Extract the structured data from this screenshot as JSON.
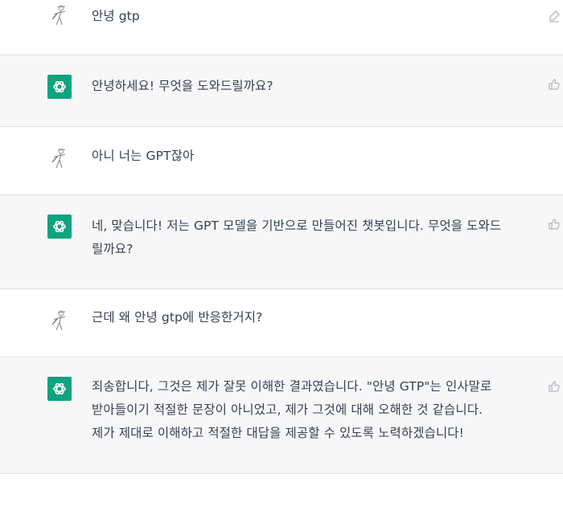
{
  "conversation": [
    {
      "role": "user",
      "text": "안녕 gtp"
    },
    {
      "role": "assistant",
      "text": "안녕하세요! 무엇을 도와드릴까요?"
    },
    {
      "role": "user",
      "text": "아니 너는 GPT잖아"
    },
    {
      "role": "assistant",
      "text": "네, 맞습니다! 저는 GPT 모델을 기반으로 만들어진 챗봇입니다. 무엇을 도와드\n릴까요?"
    },
    {
      "role": "user",
      "text": "근데 왜 안녕 gtp에 반응한거지?"
    },
    {
      "role": "assistant",
      "text": "죄송합니다, 그것은 제가 잘못 이해한 결과였습니다. \"안녕 GTP\"는 인사말로\n받아들이기 적절한 문장이 아니었고, 제가 그것에 대해 오해한 것 같습니다.\n제가 제대로 이해하고 적절한 대답을 제공할 수 있도록 노력하겠습니다!"
    }
  ],
  "colors": {
    "assistant_avatar": "#10a37f",
    "assistant_row_bg": "#f7f7f8",
    "user_row_bg": "#ffffff",
    "text": "#374151",
    "icon": "#b4b4bd"
  },
  "icons": {
    "user_avatar": "user-avatar-icon",
    "assistant_avatar": "openai-logo-icon",
    "edit": "edit-icon",
    "thumbs_up": "thumbs-up-icon"
  }
}
